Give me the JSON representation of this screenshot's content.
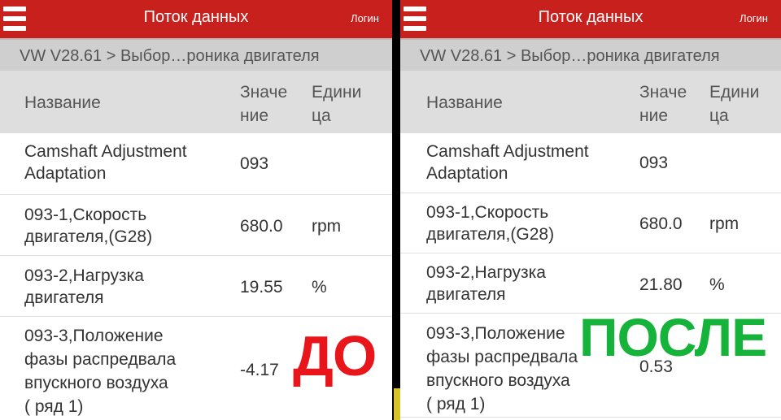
{
  "app": {
    "title": "Поток данных",
    "login": "Логин",
    "breadcrumb": "VW V28.61 > Выбор…роника двигателя"
  },
  "table": {
    "headers": {
      "name": "Название",
      "value_line1": "Значе",
      "value_line2": "ние",
      "unit_line1": "Едини",
      "unit_line2": "ца"
    }
  },
  "left": {
    "rows": [
      {
        "name_line1": "Camshaft Adjustment",
        "name_line2": "Adaptation",
        "value": "093",
        "unit": ""
      },
      {
        "name_line1": "093-1,Скорость",
        "name_line2": "двигателя,(G28)",
        "value": "680.0",
        "unit": "rpm"
      },
      {
        "name_line1": "093-2,Нагрузка",
        "name_line2": "двигателя",
        "value": "19.55",
        "unit": "%"
      },
      {
        "name_line1": "093-3,Положение",
        "name_line2": "фазы распредвала",
        "name_line3": "впускного воздуха",
        "name_line4": "( ряд 1)",
        "value": "-4.17",
        "unit": ""
      }
    ],
    "label": "ДО"
  },
  "right": {
    "rows": [
      {
        "name_line1": "Camshaft Adjustment",
        "name_line2": "Adaptation",
        "value": "093",
        "unit": ""
      },
      {
        "name_line1": "093-1,Скорость",
        "name_line2": "двигателя,(G28)",
        "value": "680.0",
        "unit": "rpm"
      },
      {
        "name_line1": "093-2,Нагрузка",
        "name_line2": "двигателя",
        "value": "21.80",
        "unit": "%"
      },
      {
        "name_line1": "093-3,Положение",
        "name_line2": "фазы распредвала",
        "name_line3": "впускного воздуха",
        "name_line4": "( ряд 1)",
        "value": "0.53",
        "unit": ""
      }
    ],
    "label": "ПОСЛЕ"
  },
  "colors": {
    "topbar": "#c8201d",
    "before_label": "#e8161b",
    "after_label": "#16b33a"
  }
}
